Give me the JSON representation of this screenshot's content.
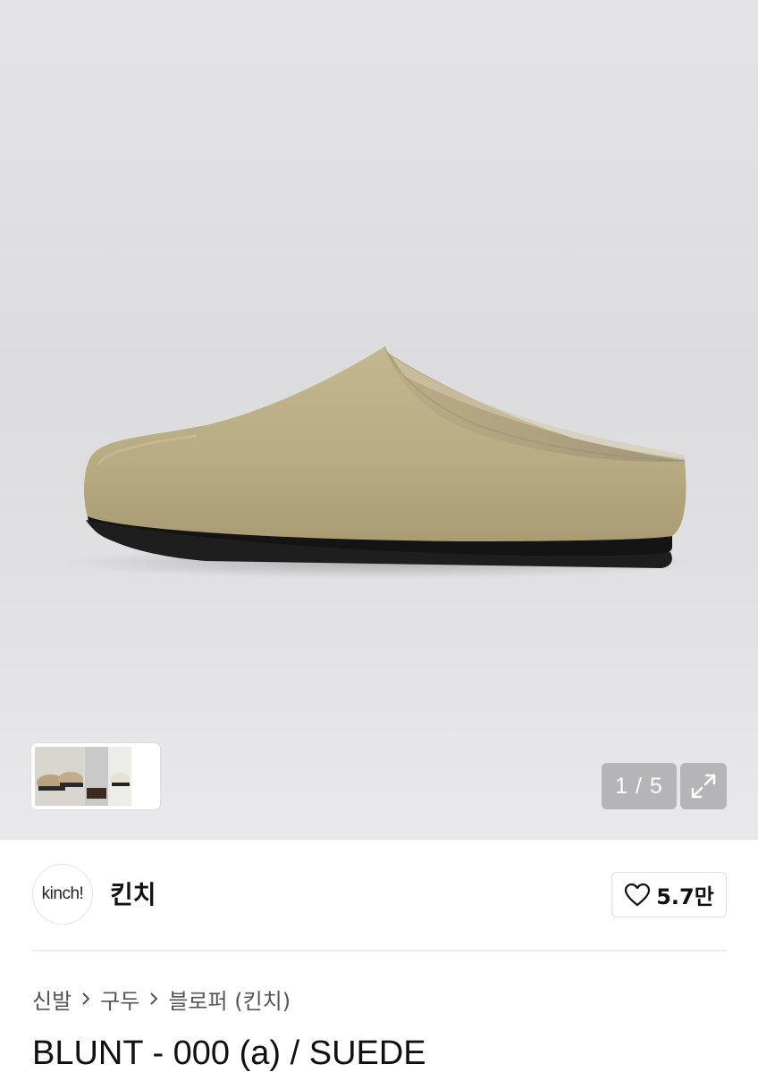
{
  "gallery": {
    "counter": "1 / 5",
    "product_image": "beige-suede-mule-shoe",
    "thumbnail_icon": "chevron-right-icon",
    "expand_icon": "expand-icon",
    "background_color": "#dedee0"
  },
  "brand": {
    "logo_text": "kinch!",
    "name": "킨치",
    "likes": "5.7만",
    "like_icon": "heart-outline-icon"
  },
  "breadcrumb": {
    "items": [
      "신발",
      "구두",
      "블로퍼 (킨치)"
    ]
  },
  "product": {
    "title": "BLUNT - 000 (a) / SUEDE"
  }
}
